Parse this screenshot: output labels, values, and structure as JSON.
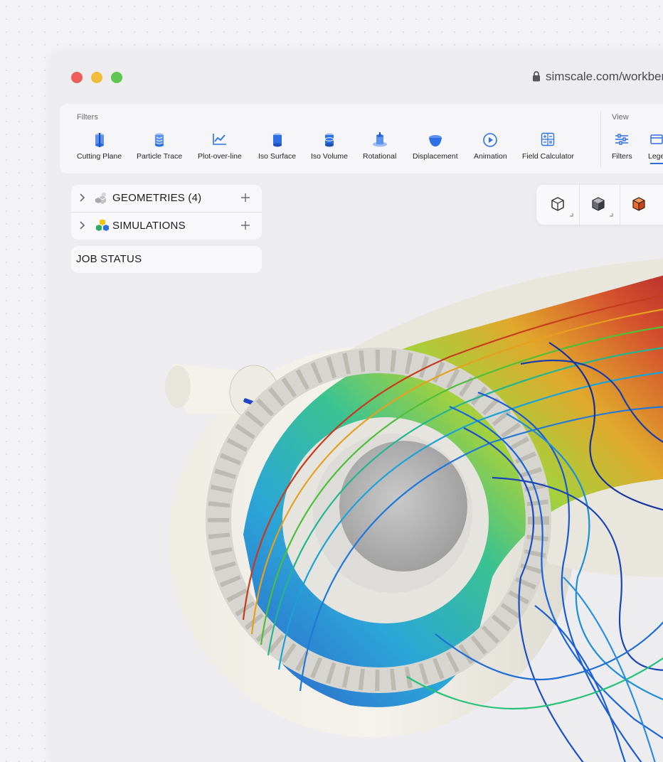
{
  "browser": {
    "url": "simscale.com/workben"
  },
  "toolbar": {
    "filters_label": "Filters",
    "view_label": "View",
    "filters": [
      {
        "label": "Cutting Plane",
        "icon": "cutting-plane-icon"
      },
      {
        "label": "Particle Trace",
        "icon": "particle-trace-icon"
      },
      {
        "label": "Plot-over-line",
        "icon": "plot-over-line-icon"
      },
      {
        "label": "Iso Surface",
        "icon": "iso-surface-icon"
      },
      {
        "label": "Iso Volume",
        "icon": "iso-volume-icon"
      },
      {
        "label": "Rotational",
        "icon": "rotational-icon"
      },
      {
        "label": "Displacement",
        "icon": "displacement-icon"
      },
      {
        "label": "Animation",
        "icon": "animation-icon"
      },
      {
        "label": "Field Calculator",
        "icon": "field-calculator-icon"
      }
    ],
    "view": [
      {
        "label": "Filters",
        "icon": "sliders-icon"
      },
      {
        "label": "Lege",
        "icon": "legend-icon"
      }
    ]
  },
  "tree": {
    "geometries_label": "GEOMETRIES (4)",
    "simulations_label": "SIMULATIONS",
    "job_status_label": "JOB STATUS"
  },
  "colors": {
    "accent": "#2d6cdf",
    "icon_blue": "#2f6fe4",
    "traffic_red": "#ec5e57",
    "traffic_yellow": "#f2bc3b",
    "traffic_green": "#5ec651",
    "orange_cube": "#ee6a2c"
  }
}
